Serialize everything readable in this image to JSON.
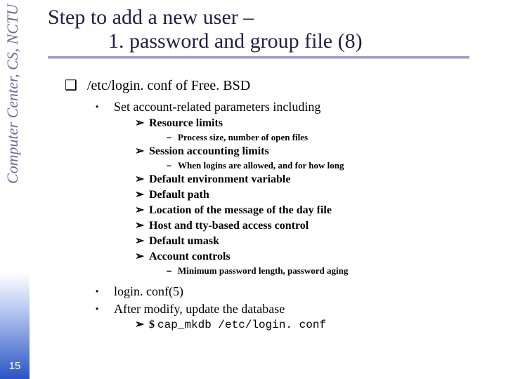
{
  "sidebar": {
    "label": "Computer Center, CS, NCTU"
  },
  "page_number": "15",
  "title": {
    "line1": "Step to add a new user –",
    "line2": "1. password and group file (8)"
  },
  "content": {
    "heading": "/etc/login. conf of Free. BSD",
    "set_params": "Set account-related parameters including",
    "items": {
      "resource_limits": "Resource limits",
      "resource_limits_detail": "Process size, number of open files",
      "session_limits": "Session accounting limits",
      "session_limits_detail": "When logins are allowed, and for how long",
      "default_env": "Default environment variable",
      "default_path": "Default path",
      "motd": "Location of the message of the day file",
      "host_tty": "Host and tty-based access control",
      "umask": "Default umask",
      "account_controls": "Account controls",
      "account_controls_detail": "Minimum password length, password aging"
    },
    "login_conf_man": "login. conf(5)",
    "after_modify": "After modify, update the database",
    "cmd_prefix": "$",
    "cmd": "cap_mkdb /etc/login. conf"
  },
  "bullets": {
    "square": "❑",
    "dot": "•",
    "arrow": "➢",
    "dash": "–"
  }
}
